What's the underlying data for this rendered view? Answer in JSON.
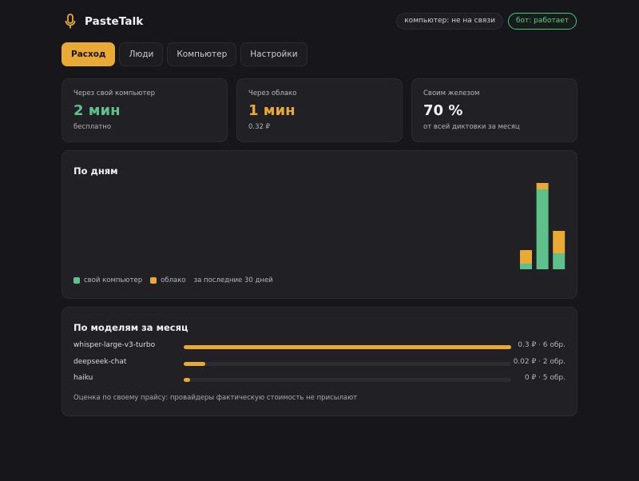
{
  "app": {
    "title": "PasteTalk"
  },
  "status": {
    "computer": "компьютер: не на связи",
    "bot": "бот: работает"
  },
  "tabs": [
    {
      "label": "Расход",
      "active": true
    },
    {
      "label": "Люди",
      "active": false
    },
    {
      "label": "Компьютер",
      "active": false
    },
    {
      "label": "Настройки",
      "active": false
    }
  ],
  "stats": [
    {
      "label": "Через свой компьютер",
      "value": "2 мин",
      "sub": "бесплатно",
      "color": "#5ec08a"
    },
    {
      "label": "Через облако",
      "value": "1 мин",
      "sub": "0.32 ₽",
      "color": "#e8a935"
    },
    {
      "label": "Своим железом",
      "value": "70 %",
      "sub": "от всей диктовки за месяц",
      "color": "#f2f2f4"
    }
  ],
  "daily": {
    "title": "По дням",
    "legend": {
      "own": "свой компьютер",
      "cloud": "облако",
      "period": "за последние 30 дней"
    }
  },
  "chart_data": {
    "type": "bar",
    "stacked": true,
    "days": 30,
    "series": [
      {
        "name": "свой компьютер",
        "color": "#5ec08a",
        "values": [
          0,
          0,
          0,
          0,
          0,
          0,
          0,
          0,
          0,
          0,
          0,
          0,
          0,
          0,
          0,
          0,
          0,
          0,
          0,
          0,
          0,
          0,
          0,
          0,
          0,
          0,
          0,
          0.07,
          1.0,
          0.2
        ]
      },
      {
        "name": "облако",
        "color": "#e8a935",
        "values": [
          0,
          0,
          0,
          0,
          0,
          0,
          0,
          0,
          0,
          0,
          0,
          0,
          0,
          0,
          0,
          0,
          0,
          0,
          0,
          0,
          0,
          0,
          0,
          0,
          0,
          0,
          0,
          0.17,
          0.08,
          0.28
        ]
      }
    ]
  },
  "models": {
    "title": "По моделям за месяц",
    "items": [
      {
        "name": "whisper-large-v3-turbo",
        "cost": "0.3 ₽ · 6 обр.",
        "fraction": 1.0
      },
      {
        "name": "deepseek-chat",
        "cost": "0.02 ₽ · 2 обр.",
        "fraction": 0.066
      },
      {
        "name": "haiku",
        "cost": "0 ₽ · 5 обр.",
        "fraction": 0.02
      }
    ],
    "note": "Оценка по своему прайсу: провайдеры фактическую стоимость не присылают"
  }
}
